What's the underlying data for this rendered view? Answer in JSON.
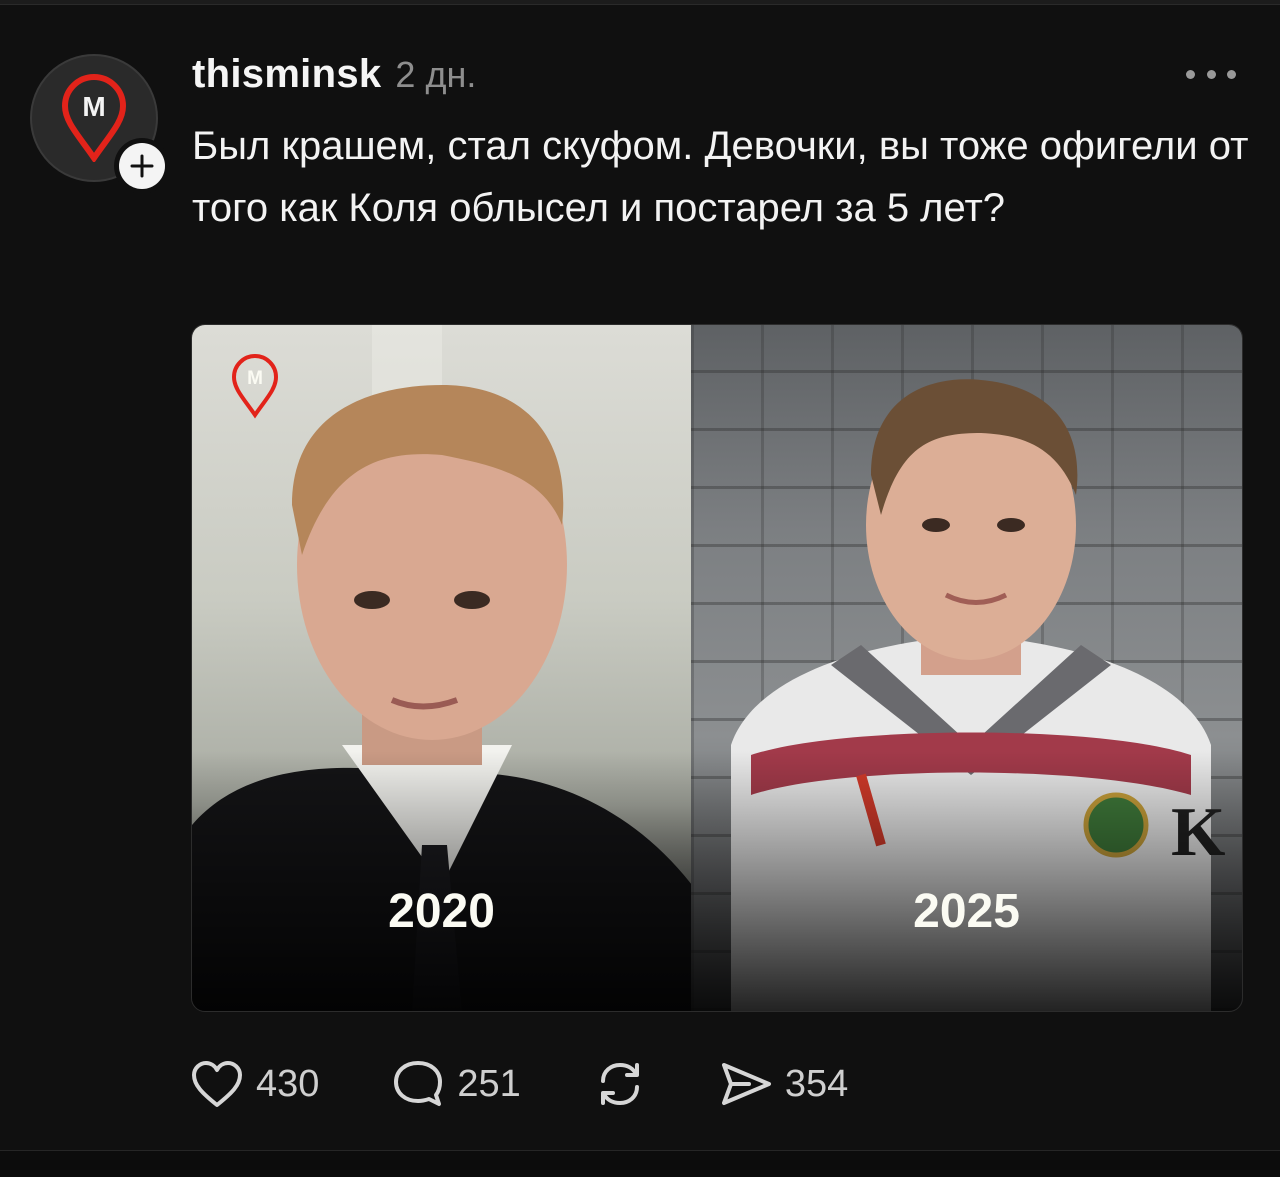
{
  "post": {
    "username": "thisminsk",
    "timestamp": "2 дн.",
    "text": "Был крашем, стал скуфом. Девочки, вы тоже офигели от того как Коля облысел и постарел за 5 лет?",
    "avatar_letter": "M",
    "more_icon": "more-horizontal-icon",
    "follow_icon": "plus-icon"
  },
  "media": {
    "left_label": "2020",
    "right_label": "2025",
    "watermark_letter": "M"
  },
  "actions": {
    "likes": "430",
    "comments": "251",
    "shares": "354",
    "like_icon": "heart-icon",
    "comment_icon": "comment-bubble-icon",
    "repost_icon": "repost-icon",
    "send_icon": "send-icon"
  },
  "colors": {
    "background": "#101010",
    "brand_red": "#e2231a",
    "text": "#f3f3f3",
    "muted": "#8e8e8e"
  }
}
